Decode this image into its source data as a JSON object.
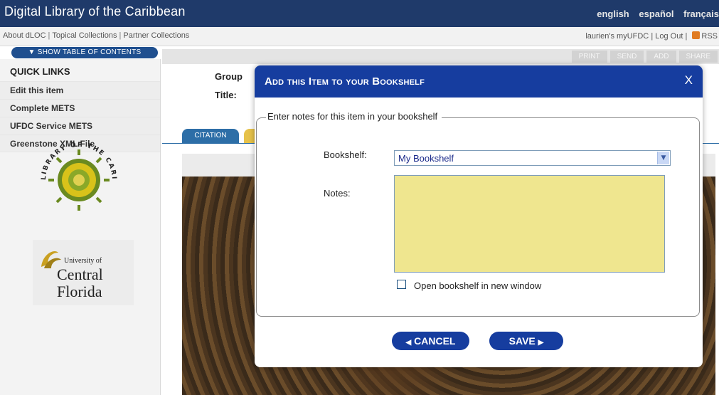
{
  "header": {
    "site_title": "Digital Library of the Caribbean",
    "languages": [
      "english",
      "español",
      "français"
    ]
  },
  "subnav": {
    "links": [
      "About dLOC",
      "Topical Collections",
      "Partner Collections"
    ],
    "user_links": [
      "laurien's myUFDC",
      "Log Out",
      "RSS"
    ]
  },
  "sidebar": {
    "toc_button": "▼ SHOW TABLE OF CONTENTS",
    "quick_links_heading": "QUICK LINKS",
    "items": [
      "Edit this item",
      "Complete METS",
      "UFDC Service METS",
      "Greenstone XML File"
    ],
    "seal_text": "LIBRARY OF THE CARIBBEAN DIGITAL",
    "ucf_logo_text_1": "University of",
    "ucf_logo_text_2": "Central",
    "ucf_logo_text_3": "Florida"
  },
  "main": {
    "toolbar": [
      "PRINT",
      "SEND",
      "ADD",
      "SHARE"
    ],
    "meta_labels": [
      "Group",
      "Title:"
    ],
    "tab_citation": "CITATION"
  },
  "modal": {
    "title": "Add this Item to your Bookshelf",
    "close": "X",
    "legend": "Enter notes for this item in your bookshelf",
    "bookshelf_label": "Bookshelf:",
    "bookshelf_value": "My Bookshelf",
    "notes_label": "Notes:",
    "notes_value": "",
    "open_new_window_label": "Open bookshelf in new window",
    "cancel_label": "CANCEL",
    "save_label": "SAVE"
  },
  "colors": {
    "header_bg": "#1f3a6a",
    "modal_header": "#163d9f",
    "notes_bg": "#efe68f",
    "button_bg": "#163d9f"
  }
}
